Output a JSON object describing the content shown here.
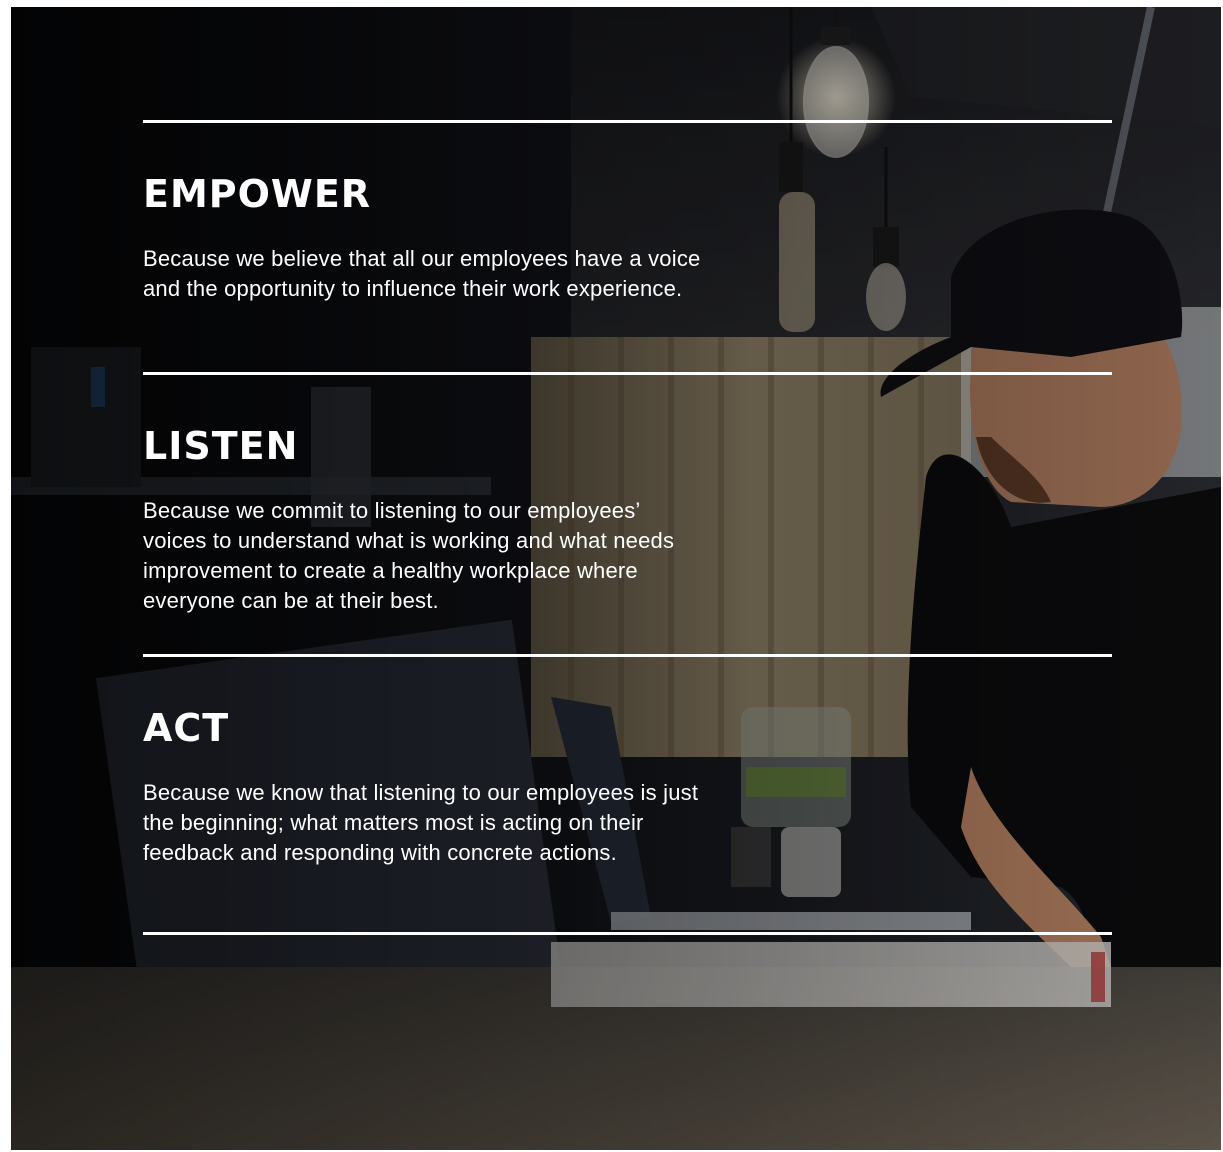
{
  "sections": [
    {
      "heading": "EMPOWER",
      "body": "Because we believe that all our employees have a voice and the opportunity to influence their work experience."
    },
    {
      "heading": "LISTEN",
      "body": "Because we commit to listening to our employees’ voices to understand what is working and what needs improvement to create a healthy workplace where everyone can be at their best."
    },
    {
      "heading": "ACT",
      "body": "Because we know that listening to our employees is just the beginning; what matters most is acting on their feedback and responding with concrete actions."
    }
  ],
  "colors": {
    "text": "#ffffff",
    "rule": "#ffffff",
    "background": "#0d0e12"
  }
}
